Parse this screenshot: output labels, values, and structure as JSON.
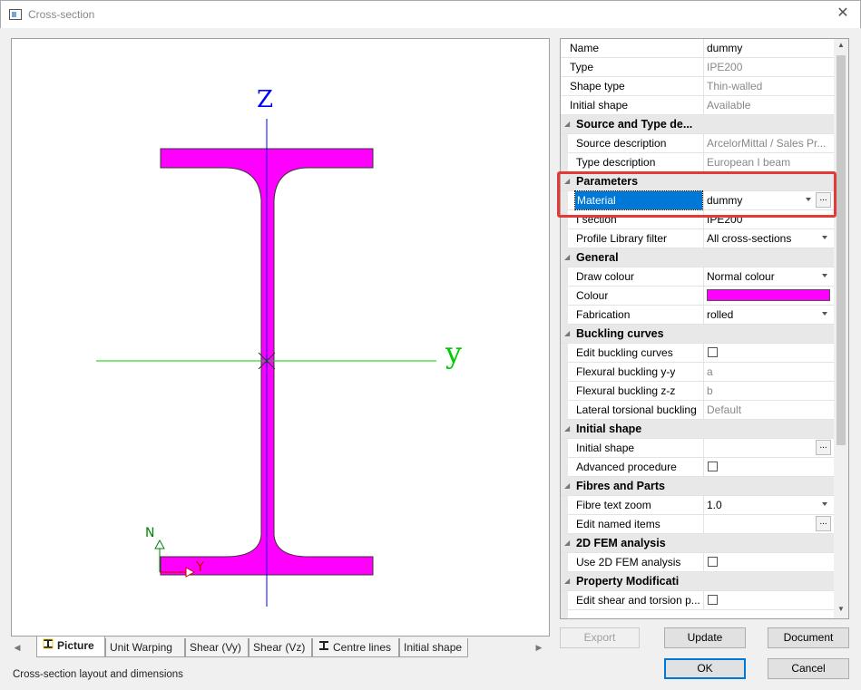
{
  "window": {
    "title": "Cross-section",
    "close_glyph": "✕"
  },
  "picture": {
    "axis_z": "Z",
    "axis_y": "y",
    "local_n": "N",
    "local_y": "Y",
    "fill_color": "#ff00ff",
    "axis_color_z": "#0000ff",
    "axis_color_y": "#00cc00"
  },
  "tabs": [
    {
      "label": "Picture",
      "icon": "i-beam-icon",
      "active": true
    },
    {
      "label": "Unit Warping"
    },
    {
      "label": "Shear (Vy)"
    },
    {
      "label": "Shear (Vz)"
    },
    {
      "label": "Centre lines",
      "icon": "i-beam-icon"
    },
    {
      "label": "Initial shape"
    }
  ],
  "status_text": "Cross-section layout and dimensions",
  "properties": {
    "name": {
      "label": "Name",
      "value": "dummy"
    },
    "type": {
      "label": "Type",
      "value": "IPE200"
    },
    "shape_type": {
      "label": "Shape type",
      "value": "Thin-walled"
    },
    "initial_shape": {
      "label": "Initial shape",
      "value": "Available"
    },
    "cat_source": "Source and Type de...",
    "source_desc": {
      "label": "Source description",
      "value": "ArcelorMittal / Sales Pr..."
    },
    "type_desc": {
      "label": "Type description",
      "value": "European I beam"
    },
    "cat_params": "Parameters",
    "material": {
      "label": "Material",
      "value": "dummy"
    },
    "isection": {
      "label": "I section",
      "value": "IPE200"
    },
    "profile_filter": {
      "label": "Profile Library filter",
      "value": "All cross-sections"
    },
    "cat_general": "General",
    "draw_colour": {
      "label": "Draw colour",
      "value": "Normal colour"
    },
    "colour": {
      "label": "Colour",
      "value": "#ff00ff"
    },
    "fabrication": {
      "label": "Fabrication",
      "value": "rolled"
    },
    "cat_buckling": "Buckling curves",
    "edit_buckling": {
      "label": "Edit buckling curves",
      "checked": false
    },
    "flex_yy": {
      "label": "Flexural buckling y-y",
      "value": "a"
    },
    "flex_zz": {
      "label": "Flexural buckling z-z",
      "value": "b"
    },
    "lat_tors": {
      "label": "Lateral torsional buckling",
      "value": "Default"
    },
    "cat_initial": "Initial shape",
    "initial_shape2": {
      "label": "Initial shape",
      "value": ""
    },
    "advanced": {
      "label": "Advanced procedure",
      "checked": false
    },
    "cat_fibres": "Fibres and Parts",
    "fibre_zoom": {
      "label": "Fibre text zoom",
      "value": "1.0"
    },
    "edit_named": {
      "label": "Edit named items",
      "value": ""
    },
    "cat_fem": "2D FEM analysis",
    "use_fem": {
      "label": "Use 2D FEM analysis",
      "checked": false
    },
    "cat_propmod": "Property Modificati",
    "edit_shear": {
      "label": "Edit shear and torsion p...",
      "checked": false
    }
  },
  "buttons": {
    "export": "Export",
    "update": "Update",
    "document": "Document",
    "ok": "OK",
    "cancel": "Cancel"
  }
}
